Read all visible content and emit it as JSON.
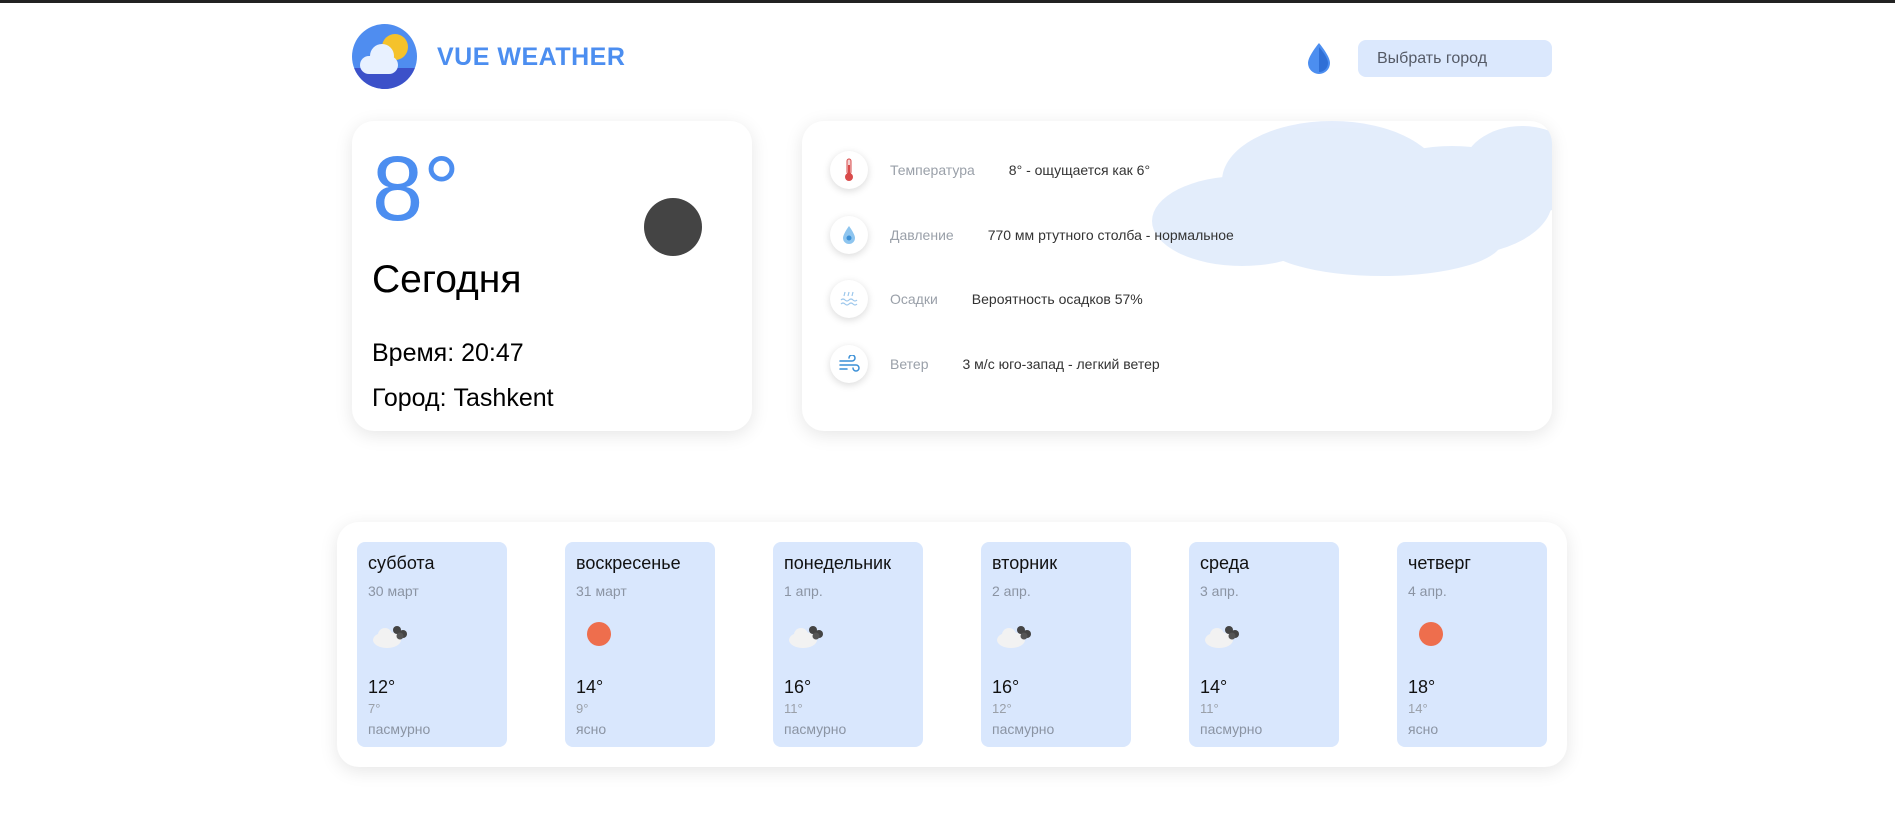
{
  "header": {
    "brand": "VUE WEATHER",
    "city_button": "Выбрать город",
    "logo_icon": "cloud-sun-logo-icon",
    "theme_icon": "drop-icon"
  },
  "today": {
    "temperature": "8°",
    "day": "Сегодня",
    "time": "Время: 20:47",
    "city": "Город: Tashkent",
    "icon": "moon-icon"
  },
  "details": [
    {
      "icon": "thermometer-icon",
      "label": "Температура",
      "value": "8° - ощущается как 6°"
    },
    {
      "icon": "pressure-drop-icon",
      "label": "Давление",
      "value": "770 мм ртутного столба - нормальное"
    },
    {
      "icon": "precipitation-icon",
      "label": "Осадки",
      "value": "Вероятность осадков 57%"
    },
    {
      "icon": "wind-icon",
      "label": "Ветер",
      "value": "3 м/с юго-запад - легкий ветер"
    }
  ],
  "forecast": [
    {
      "day": "суббота",
      "date": "30 март",
      "icon": "cloudy-icon",
      "high": "12°",
      "low": "7°",
      "desc": "пасмурно"
    },
    {
      "day": "воскресенье",
      "date": "31 март",
      "icon": "sun-icon",
      "high": "14°",
      "low": "9°",
      "desc": "ясно"
    },
    {
      "day": "понедельник",
      "date": "1 апр.",
      "icon": "cloudy-icon",
      "high": "16°",
      "low": "11°",
      "desc": "пасмурно"
    },
    {
      "day": "вторник",
      "date": "2 апр.",
      "icon": "cloudy-icon",
      "high": "16°",
      "low": "12°",
      "desc": "пасмурно"
    },
    {
      "day": "среда",
      "date": "3 апр.",
      "icon": "cloudy-icon",
      "high": "14°",
      "low": "11°",
      "desc": "пасмурно"
    },
    {
      "day": "четверг",
      "date": "4 апр.",
      "icon": "sun-icon",
      "high": "18°",
      "low": "14°",
      "desc": "ясно"
    }
  ],
  "colors": {
    "accent": "#4c8ef0",
    "card_blue": "#d9e7fd",
    "sun": "#ee6e4d"
  }
}
